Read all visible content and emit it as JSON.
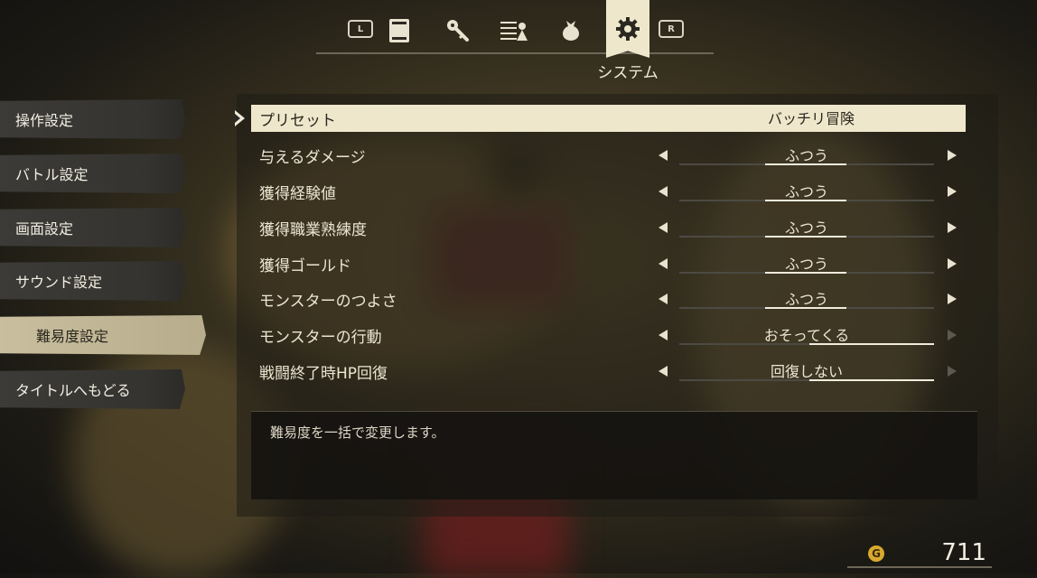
{
  "top_tabs": {
    "left_shoulder": "L",
    "right_shoulder": "R",
    "icons": [
      "journal-icon",
      "key-item-icon",
      "party-icon",
      "bag-icon",
      "gear-icon"
    ],
    "active_label": "システム"
  },
  "sidebar": {
    "items": [
      {
        "label": "操作設定",
        "active": false
      },
      {
        "label": "バトル設定",
        "active": false
      },
      {
        "label": "画面設定",
        "active": false
      },
      {
        "label": "サウンド設定",
        "active": false
      },
      {
        "label": "難易度設定",
        "active": true
      },
      {
        "label": "タイトルへもどる",
        "active": false
      }
    ]
  },
  "settings": {
    "rows": [
      {
        "label": "プリセット",
        "value": "バッチリ冒険",
        "selected": true
      },
      {
        "label": "与えるダメージ",
        "value": "ふつう"
      },
      {
        "label": "獲得経験値",
        "value": "ふつう"
      },
      {
        "label": "獲得職業熟練度",
        "value": "ふつう"
      },
      {
        "label": "獲得ゴールド",
        "value": "ふつう"
      },
      {
        "label": "モンスターのつよさ",
        "value": "ふつう"
      },
      {
        "label": "モンスターの行動",
        "value": "おそってくる"
      },
      {
        "label": "戦闘終了時HP回復",
        "value": "回復しない"
      }
    ]
  },
  "description": "難易度を一括で変更します。",
  "gold": {
    "icon_letter": "G",
    "amount": "711"
  },
  "colors": {
    "highlight": "#efe7cc",
    "gold": "#d9a92e"
  }
}
